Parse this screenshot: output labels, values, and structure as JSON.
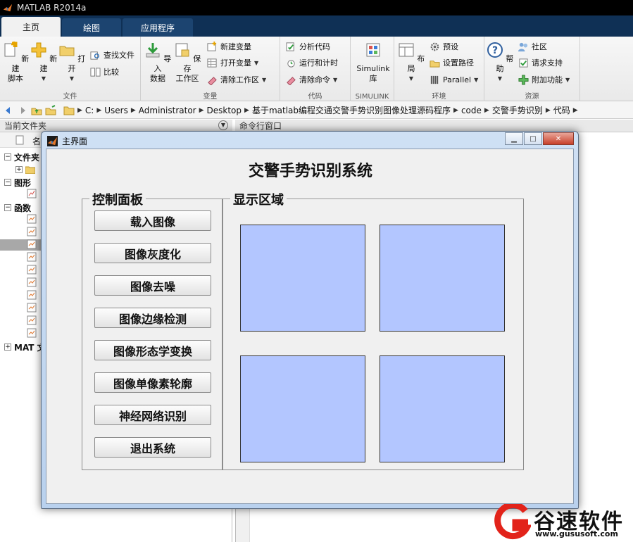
{
  "app": {
    "title": "MATLAB R2014a"
  },
  "tabs": [
    {
      "label": "主页"
    },
    {
      "label": "绘图"
    },
    {
      "label": "应用程序"
    }
  ],
  "ribbon": {
    "file": {
      "label": "文件",
      "new_script": "新建\n脚本",
      "new": "新建",
      "open": "打开",
      "find_files": "查找文件",
      "compare": "比较"
    },
    "variable": {
      "label": "变量",
      "import_data": "导入\n数据",
      "save_workspace": "保存\n工作区",
      "new_variable": "新建变量",
      "open_variable": "打开变量",
      "clear_workspace": "清除工作区"
    },
    "code": {
      "label": "代码",
      "analyze_code": "分析代码",
      "run_and_time": "运行和计时",
      "clear_commands": "清除命令"
    },
    "simulink": {
      "label": "SIMULINK",
      "library": "Simulink\n库"
    },
    "environment": {
      "label": "环境",
      "layout": "布局",
      "preferences": "预设",
      "set_path": "设置路径",
      "parallel": "Parallel"
    },
    "resources": {
      "label": "资源",
      "help": "帮助",
      "community": "社区",
      "request_support": "请求支持",
      "add_ons": "附加功能"
    }
  },
  "address": {
    "crumbs": [
      "C:",
      "Users",
      "Administrator",
      "Desktop",
      "基于matlab编程交通交警手势识别图像处理源码程序",
      "code",
      "交警手势识别",
      "代码"
    ]
  },
  "panels": {
    "current_folder": "当前文件夹",
    "command_window": "命令行窗口",
    "name_col": "名",
    "tree": {
      "folders": "文件夹",
      "figures": "图形",
      "functions": "函数",
      "mat": "MAT 文"
    }
  },
  "dialog": {
    "title": "主界面",
    "system_title": "交警手势识别系统",
    "control_panel": "控制面板",
    "display_area": "显示区域",
    "buttons": [
      "载入图像",
      "图像灰度化",
      "图像去噪",
      "图像边缘检测",
      "图像形态学变换",
      "图像单像素轮廓",
      "神经网络识别",
      "退出系统"
    ]
  },
  "watermark": {
    "brand": "谷速软件",
    "url": "www.gususoft.com"
  }
}
